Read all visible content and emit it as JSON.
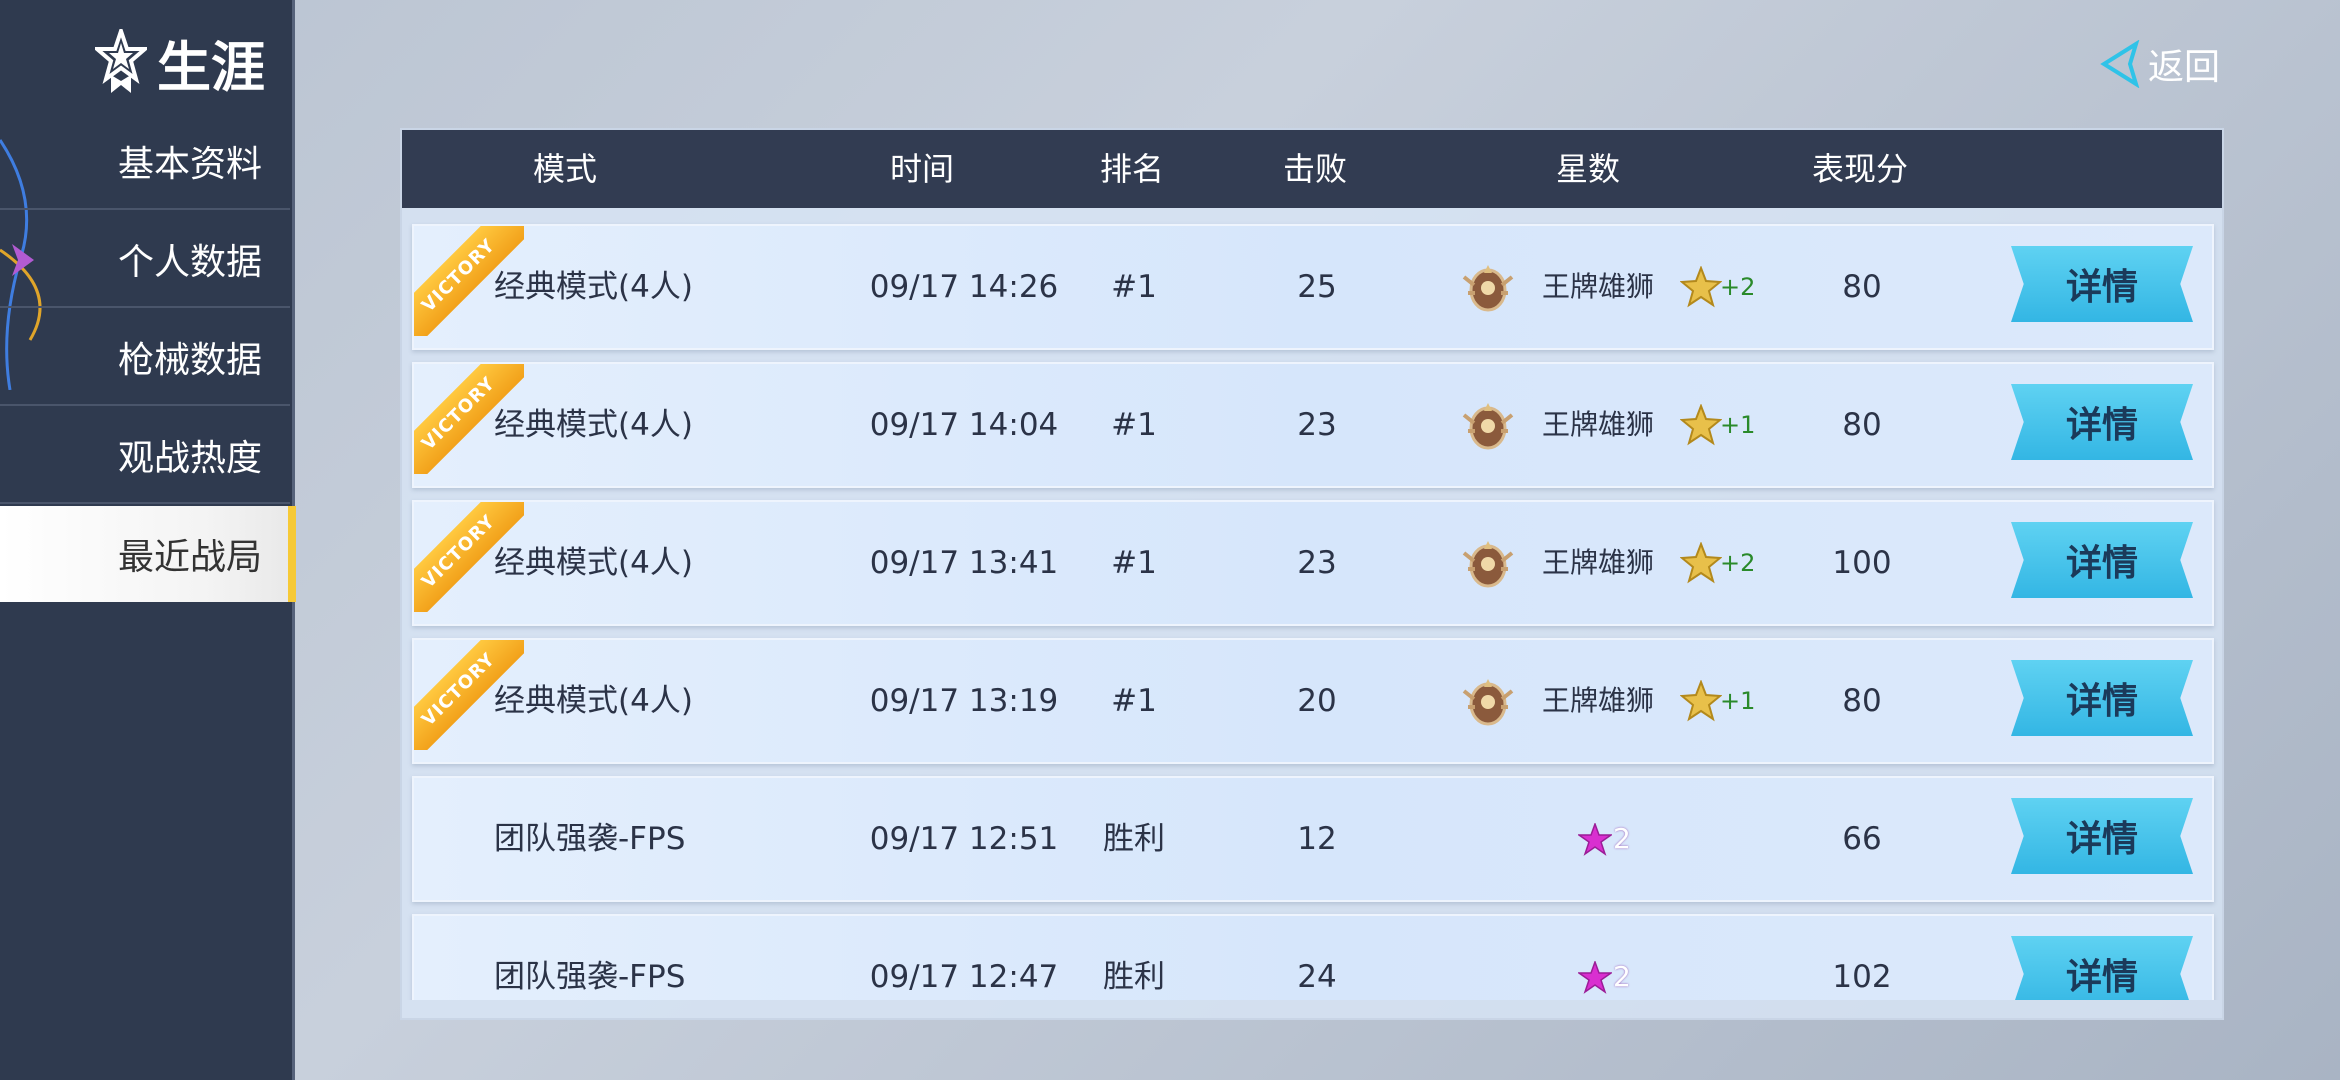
{
  "sidebar": {
    "title": "生涯",
    "items": [
      {
        "label": "基本资料",
        "active": false
      },
      {
        "label": "个人数据",
        "active": false
      },
      {
        "label": "枪械数据",
        "active": false
      },
      {
        "label": "观战热度",
        "active": false
      },
      {
        "label": "最近战局",
        "active": true
      }
    ]
  },
  "back": {
    "label": "返回"
  },
  "table": {
    "headers": [
      "模式",
      "时间",
      "排名",
      "击败",
      "星数",
      "表现分"
    ],
    "detail_label": "详情",
    "victory_label": "VICTORY",
    "rows": [
      {
        "mode": "经典模式(4人)",
        "time": "09/17 14:26",
        "rank": "#1",
        "kills": "25",
        "tier": "王牌雄狮",
        "stars": "+2",
        "score": "80",
        "victory": true
      },
      {
        "mode": "经典模式(4人)",
        "time": "09/17 14:04",
        "rank": "#1",
        "kills": "23",
        "tier": "王牌雄狮",
        "stars": "+1",
        "score": "80",
        "victory": true
      },
      {
        "mode": "经典模式(4人)",
        "time": "09/17 13:41",
        "rank": "#1",
        "kills": "23",
        "tier": "王牌雄狮",
        "stars": "+2",
        "score": "100",
        "victory": true
      },
      {
        "mode": "经典模式(4人)",
        "time": "09/17 13:19",
        "rank": "#1",
        "kills": "20",
        "tier": "王牌雄狮",
        "stars": "+1",
        "score": "80",
        "victory": true
      },
      {
        "mode": "团队强袭-FPS",
        "time": "09/17 12:51",
        "rank": "胜利",
        "kills": "12",
        "stars": "2",
        "score": "66",
        "victory": false
      },
      {
        "mode": "团队强袭-FPS",
        "time": "09/17 12:47",
        "rank": "胜利",
        "kills": "24",
        "stars": "2",
        "score": "102",
        "victory": false
      }
    ]
  }
}
